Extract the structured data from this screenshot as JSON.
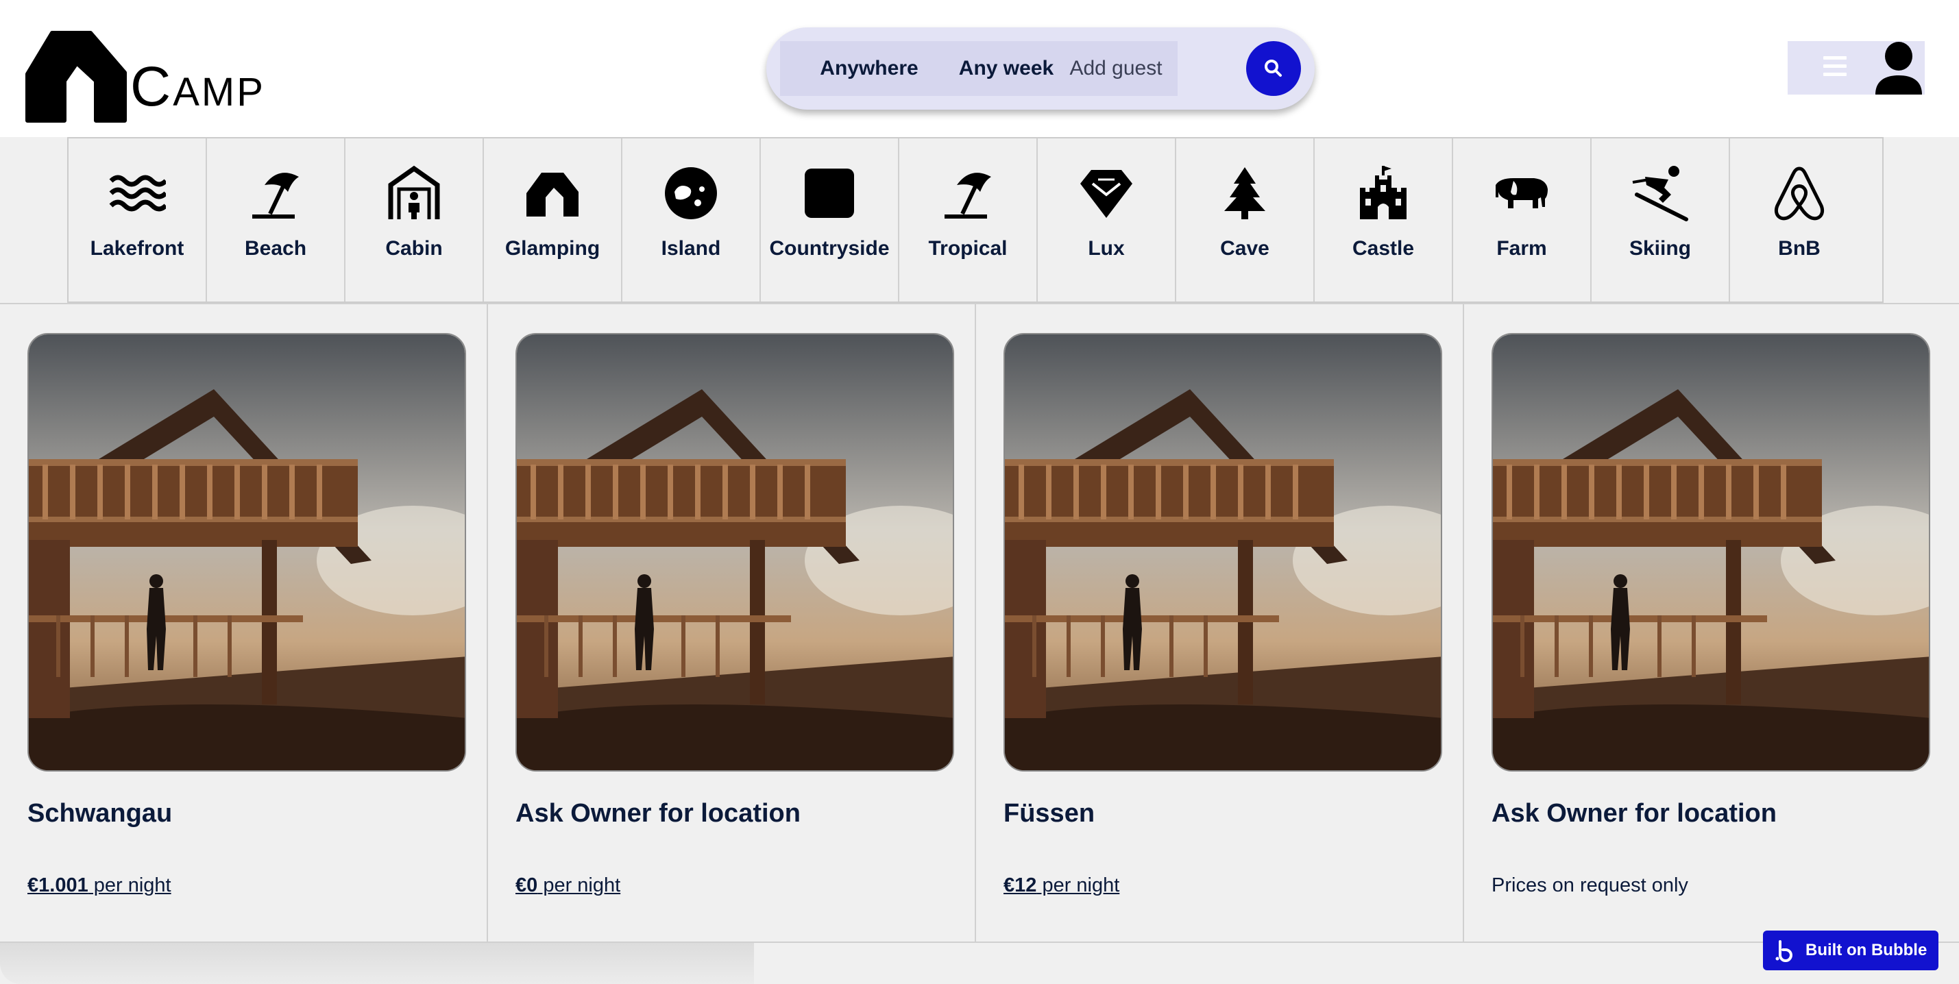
{
  "header": {
    "logo_text_first": "C",
    "logo_text_rest": "AMP",
    "search": {
      "where_label": "Anywhere",
      "week_label": "Any week",
      "guest_label": "Add guest",
      "search_icon": "search-icon",
      "accent_color": "#1212cf"
    },
    "menu_icon": "hamburger-icon",
    "avatar_icon": "user-avatar-icon"
  },
  "categories": [
    {
      "label": "Lakefront",
      "icon": "waves-icon"
    },
    {
      "label": "Beach",
      "icon": "beach-umbrella-icon"
    },
    {
      "label": "Cabin",
      "icon": "cabin-icon"
    },
    {
      "label": "Glamping",
      "icon": "tent-icon"
    },
    {
      "label": "Island",
      "icon": "island-icon"
    },
    {
      "label": "Countryside",
      "icon": "square-icon"
    },
    {
      "label": "Tropical",
      "icon": "tropical-umbrella-icon"
    },
    {
      "label": "Lux",
      "icon": "diamond-icon"
    },
    {
      "label": "Cave",
      "icon": "tree-icon"
    },
    {
      "label": "Castle",
      "icon": "castle-icon"
    },
    {
      "label": "Farm",
      "icon": "elephant-icon"
    },
    {
      "label": "Skiing",
      "icon": "skiing-icon"
    },
    {
      "label": "BnB",
      "icon": "bnb-icon"
    }
  ],
  "listings": [
    {
      "title": "Schwangau",
      "amount": "€1.001",
      "suffix": " per night",
      "price_text": ""
    },
    {
      "title": "Ask Owner for location",
      "amount": "€0",
      "suffix": " per night",
      "price_text": ""
    },
    {
      "title": "Füssen",
      "amount": "€12",
      "suffix": " per night",
      "price_text": ""
    },
    {
      "title": "Ask Owner for location",
      "amount": "",
      "suffix": "",
      "price_text": "Prices on request only"
    }
  ],
  "badge": {
    "label": "Built on Bubble",
    "icon": "bubble-logo-icon"
  }
}
